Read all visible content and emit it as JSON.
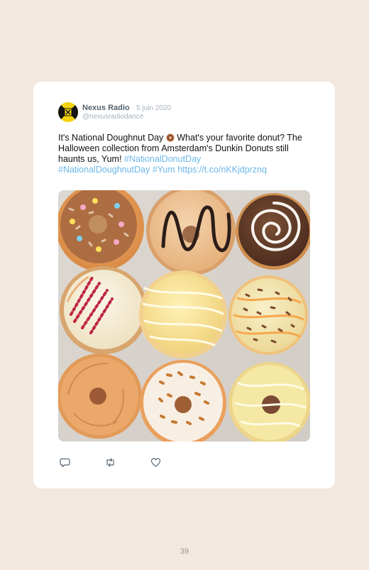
{
  "tweet": {
    "author_name": "Nexus Radio",
    "date_separator": "·",
    "date": "5 juin 2020",
    "handle": "@nexusradiodance",
    "text_part1": "It's National Doughnut Day ",
    "text_part2": " What's your favorite donut? The Halloween collection from Amsterdam's Dunkin Donuts still haunts us, Yum! ",
    "hashtag1": "#NationalDonutDay",
    "hashtag2": "#NationalDoughnutDay",
    "hashtag3": "#Yum",
    "short_link": "https://t.co/nKKjdprznq",
    "emoji_name": "doughnut-emoji"
  },
  "photo": {
    "description_icon": "photo-of-nine-donuts"
  },
  "actions": {
    "reply_icon": "reply-icon",
    "retweet_icon": "retweet-icon",
    "like_icon": "heart-icon"
  },
  "page": {
    "number": "39"
  },
  "colors": {
    "background": "#f3e8df",
    "card": "#ffffff",
    "link": "#6cb7ea",
    "meta_gray": "#a7b1ba"
  }
}
